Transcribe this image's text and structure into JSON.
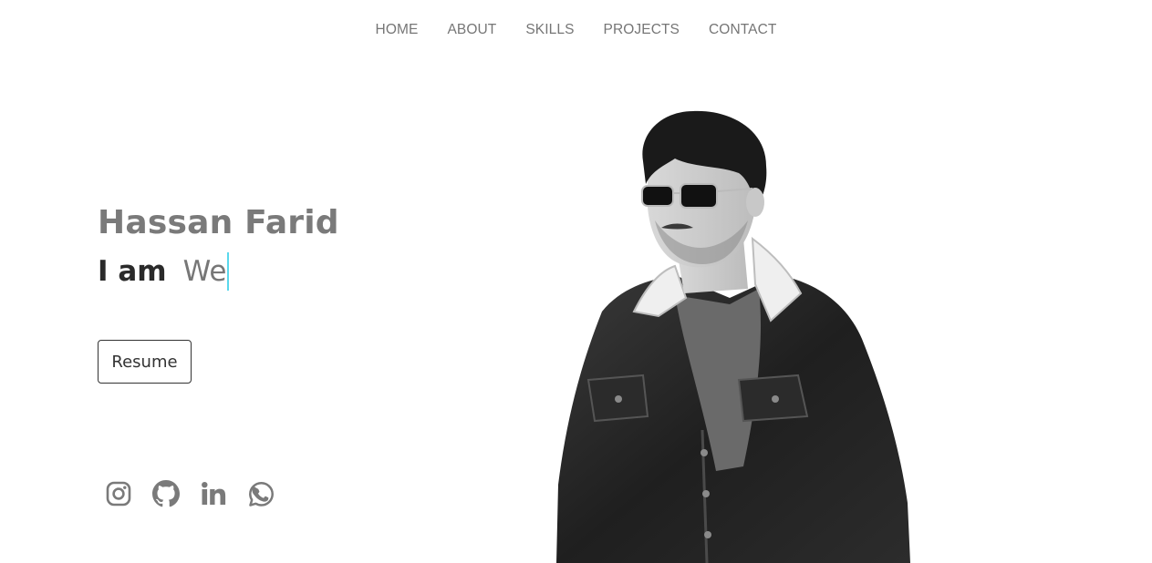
{
  "nav": {
    "items": [
      {
        "label": "HOME"
      },
      {
        "label": "ABOUT"
      },
      {
        "label": "SKILLS"
      },
      {
        "label": "PROJECTS"
      },
      {
        "label": "CONTACT"
      }
    ]
  },
  "hero": {
    "name": "Hassan Farid",
    "role_prefix": "I am",
    "role_typed": "We",
    "resume_label": "Resume"
  },
  "socials": [
    {
      "icon": "instagram-icon"
    },
    {
      "icon": "github-icon"
    },
    {
      "icon": "linkedin-icon"
    },
    {
      "icon": "whatsapp-icon"
    }
  ],
  "colors": {
    "nav_text": "#767676",
    "name_text": "#7a7a7a",
    "cursor": "#5ad8ec",
    "icon": "#7a7a7a"
  }
}
